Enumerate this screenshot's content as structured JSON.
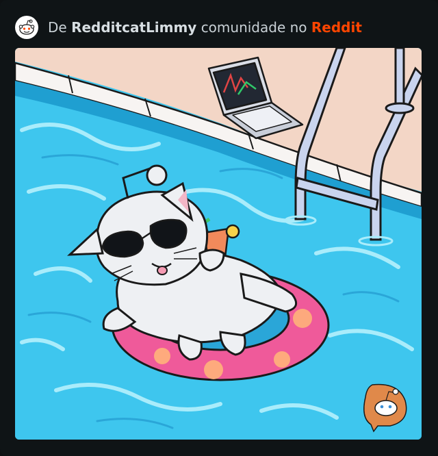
{
  "header": {
    "prefix": "De",
    "username": "RedditcatLimmy",
    "middle": "comunidade no",
    "brand": "Reddit",
    "avatar_icon": "reddit-snoo-avatar-icon"
  },
  "image": {
    "icon": "cat-floating-in-pool-illustration",
    "watermark_icon": "reddit-watermark-icon"
  },
  "colors": {
    "background": "#0e1113",
    "brand": "#ff4500",
    "header_text": "#c9d1d6",
    "pool": "#3ec6ee",
    "float": "#ef5a9a"
  }
}
